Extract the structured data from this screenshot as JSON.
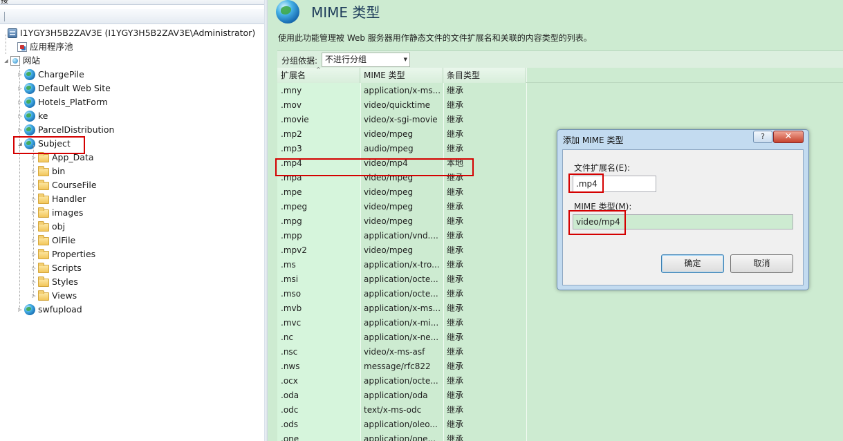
{
  "left_header": "接",
  "tree": {
    "server": "I1YGY3H5B2ZAV3E (I1YGY3H5B2ZAV3E\\Administrator)",
    "app_pools": "应用程序池",
    "sites": "网站",
    "site_items": [
      "ChargePile",
      "Default Web Site",
      "Hotels_PlatForm",
      "ke",
      "ParcelDistribution"
    ],
    "selected_site": "Subject",
    "subject_folders": [
      "App_Data",
      "bin",
      "CourseFile",
      "Handler",
      "images",
      "obj",
      "OlFile",
      "Properties",
      "Scripts",
      "Styles",
      "Views"
    ],
    "last_site": "swfupload"
  },
  "page": {
    "title": "MIME 类型",
    "description": "使用此功能管理被 Web 服务器用作静态文件的文件扩展名和关联的内容类型的列表。",
    "group_label": "分组依据:",
    "group_value": "不进行分组"
  },
  "grid": {
    "headers": [
      "扩展名",
      "MIME 类型",
      "条目类型"
    ],
    "rows": [
      [
        ".mny",
        "application/x-ms...",
        "继承"
      ],
      [
        ".mov",
        "video/quicktime",
        "继承"
      ],
      [
        ".movie",
        "video/x-sgi-movie",
        "继承"
      ],
      [
        ".mp2",
        "video/mpeg",
        "继承"
      ],
      [
        ".mp3",
        "audio/mpeg",
        "继承"
      ],
      [
        ".mp4",
        "video/mp4",
        "本地"
      ],
      [
        ".mpa",
        "video/mpeg",
        "继承"
      ],
      [
        ".mpe",
        "video/mpeg",
        "继承"
      ],
      [
        ".mpeg",
        "video/mpeg",
        "继承"
      ],
      [
        ".mpg",
        "video/mpeg",
        "继承"
      ],
      [
        ".mpp",
        "application/vnd....",
        "继承"
      ],
      [
        ".mpv2",
        "video/mpeg",
        "继承"
      ],
      [
        ".ms",
        "application/x-tro...",
        "继承"
      ],
      [
        ".msi",
        "application/octe...",
        "继承"
      ],
      [
        ".mso",
        "application/octe...",
        "继承"
      ],
      [
        ".mvb",
        "application/x-ms...",
        "继承"
      ],
      [
        ".mvc",
        "application/x-mi...",
        "继承"
      ],
      [
        ".nc",
        "application/x-ne...",
        "继承"
      ],
      [
        ".nsc",
        "video/x-ms-asf",
        "继承"
      ],
      [
        ".nws",
        "message/rfc822",
        "继承"
      ],
      [
        ".ocx",
        "application/octe...",
        "继承"
      ],
      [
        ".oda",
        "application/oda",
        "继承"
      ],
      [
        ".odc",
        "text/x-ms-odc",
        "继承"
      ],
      [
        ".ods",
        "application/oleo...",
        "继承"
      ],
      [
        ".one",
        "application/one...",
        "继承"
      ]
    ]
  },
  "dialog": {
    "title": "添加 MIME 类型",
    "help": "?",
    "close": "✕",
    "ext_label": "文件扩展名(E):",
    "ext_value": ".mp4",
    "mime_label": "MIME 类型(M):",
    "mime_value": "video/mp4",
    "ok": "确定",
    "cancel": "取消"
  },
  "colors": {
    "highlight_red": "#d40000",
    "pane_green": "#cdebd1"
  }
}
